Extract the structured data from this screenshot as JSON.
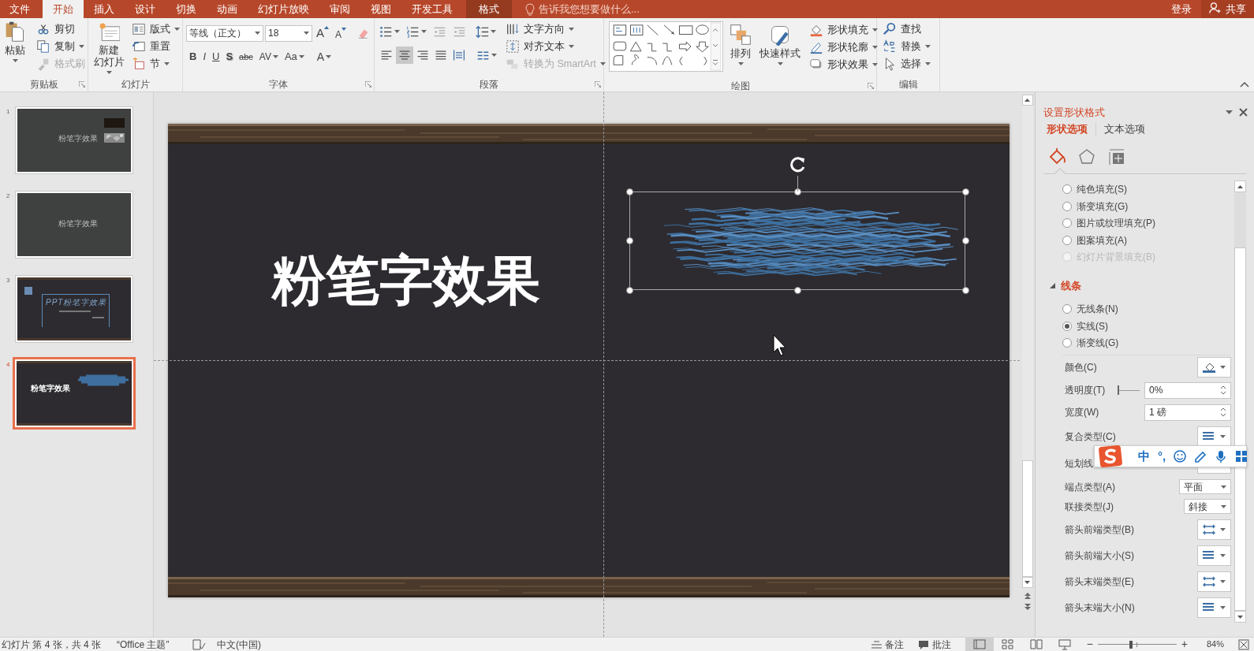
{
  "tabs": [
    {
      "label": "文件",
      "kind": "file",
      "selected": false
    },
    {
      "label": "开始",
      "kind": "normal",
      "selected": true
    },
    {
      "label": "插入",
      "kind": "normal",
      "selected": false
    },
    {
      "label": "设计",
      "kind": "normal",
      "selected": false
    },
    {
      "label": "切换",
      "kind": "normal",
      "selected": false
    },
    {
      "label": "动画",
      "kind": "normal",
      "selected": false
    },
    {
      "label": "幻灯片放映",
      "kind": "normal",
      "selected": false
    },
    {
      "label": "审阅",
      "kind": "normal",
      "selected": false
    },
    {
      "label": "视图",
      "kind": "normal",
      "selected": false
    },
    {
      "label": "开发工具",
      "kind": "normal",
      "selected": false
    },
    {
      "label": "格式",
      "kind": "contextual",
      "selected": false
    }
  ],
  "tell_me": {
    "placeholder": "告诉我您想要做什么..."
  },
  "sign_in": "登录",
  "share": "共享",
  "ribbon": [
    {
      "kind": "clipboard",
      "label": "剪贴板",
      "launcher": true,
      "large": {
        "label": "粘贴",
        "dropdown": true
      },
      "small": [
        {
          "label": "剪切",
          "dropdown": false,
          "disabled": false
        },
        {
          "label": "复制",
          "dropdown": true,
          "disabled": false
        },
        {
          "label": "格式刷",
          "dropdown": false,
          "disabled": true
        }
      ]
    },
    {
      "kind": "slides",
      "label": "幻灯片",
      "launcher": false,
      "large": {
        "label_lines": [
          "新建",
          "幻灯片"
        ],
        "dropdown": true
      },
      "small": [
        {
          "label": "版式",
          "dropdown": true,
          "disabled": false
        },
        {
          "label": "重置",
          "dropdown": false,
          "disabled": false
        },
        {
          "label": "节",
          "dropdown": true,
          "disabled": false
        }
      ]
    },
    {
      "kind": "font",
      "label": "字体",
      "launcher": true,
      "font_name": {
        "value": "等线（正文）"
      },
      "font_size": {
        "value": "18"
      },
      "grow": "A",
      "shrink": "A",
      "buttons": [
        {
          "label": "B",
          "dropdown": false
        },
        {
          "label": "I",
          "dropdown": false
        },
        {
          "label": "U",
          "dropdown": false
        },
        {
          "label": "S",
          "dropdown": false
        },
        {
          "label": "abc",
          "dropdown": false
        },
        {
          "label": "AV",
          "dropdown": true
        },
        {
          "label": "Aa",
          "dropdown": true
        },
        {
          "label": "A",
          "dropdown": true
        }
      ]
    },
    {
      "kind": "paragraph",
      "label": "段落",
      "launcher": true,
      "align_buttons": [
        {
          "selected": false
        },
        {
          "selected": true
        },
        {
          "selected": false
        },
        {
          "selected": false
        },
        {
          "selected": false
        }
      ],
      "small": [
        {
          "label": "文字方向",
          "dropdown": true,
          "disabled": false
        },
        {
          "label": "对齐文本",
          "dropdown": true,
          "disabled": false
        },
        {
          "label": "转换为 SmartArt",
          "dropdown": true,
          "disabled": true
        }
      ]
    },
    {
      "kind": "drawing",
      "label": "绘图",
      "launcher": true,
      "large": [
        {
          "label": "排列",
          "dropdown": true
        },
        {
          "label": "快速样式",
          "dropdown": true
        }
      ],
      "small": [
        {
          "label": "形状填充",
          "dropdown": true,
          "disabled": false
        },
        {
          "label": "形状轮廓",
          "dropdown": true,
          "disabled": false
        },
        {
          "label": "形状效果",
          "dropdown": true,
          "disabled": false
        }
      ]
    },
    {
      "kind": "editing",
      "label": "编辑",
      "launcher": false,
      "small": [
        {
          "label": "查找",
          "dropdown": false,
          "disabled": false
        },
        {
          "label": "替换",
          "dropdown": true,
          "disabled": false
        },
        {
          "label": "选择",
          "dropdown": true,
          "disabled": false
        }
      ]
    }
  ],
  "slides": [
    {
      "number": "1",
      "kind": "grey_logo",
      "title": "粉笔字效果",
      "selected": false
    },
    {
      "number": "2",
      "kind": "grey",
      "title": "粉笔字效果",
      "selected": false
    },
    {
      "number": "3",
      "kind": "chalk",
      "title": "PPT粉笔字效果",
      "selected": false
    },
    {
      "number": "4",
      "kind": "board",
      "title": "粉笔字效果",
      "selected": true
    }
  ],
  "slide": {
    "title": "粉笔字效果"
  },
  "format_pane": {
    "title": "设置形状格式",
    "tabs": [
      {
        "label": "形状选项",
        "selected": true
      },
      {
        "label": "文本选项",
        "selected": false
      }
    ],
    "icon_tabs": [
      {
        "selected": true
      },
      {
        "selected": false
      },
      {
        "selected": false
      }
    ],
    "fill_options": [
      {
        "label": "纯色填充(S)",
        "selected": false,
        "disabled": false
      },
      {
        "label": "渐变填充(G)",
        "selected": false,
        "disabled": false
      },
      {
        "label": "图片或纹理填充(P)",
        "selected": false,
        "disabled": false
      },
      {
        "label": "图案填充(A)",
        "selected": false,
        "disabled": false
      },
      {
        "label": "幻灯片背景填充(B)",
        "selected": false,
        "disabled": true
      }
    ],
    "line_section": {
      "title": "线条",
      "expanded": true,
      "options": [
        {
          "label": "无线条(N)",
          "selected": false
        },
        {
          "label": "实线(S)",
          "selected": true
        },
        {
          "label": "渐变线(G)",
          "selected": false
        }
      ],
      "properties": [
        {
          "label": "颜色(C)",
          "kind": "color"
        },
        {
          "label": "透明度(T)",
          "kind": "slider",
          "level": 0,
          "value": "0%"
        },
        {
          "label": "宽度(W)",
          "kind": "spin",
          "value": "1 磅"
        },
        {
          "label": "复合类型(C)",
          "kind": "lines"
        },
        {
          "label": "短划线",
          "kind": "dash"
        },
        {
          "label": "端点类型(A)",
          "kind": "dropdown",
          "value": "平面"
        },
        {
          "label": "联接类型(J)",
          "kind": "dropdown",
          "value": "斜接"
        },
        {
          "label": "箭头前端类型(B)",
          "kind": "arrows"
        },
        {
          "label": "箭头前端大小(S)",
          "kind": "lines"
        },
        {
          "label": "箭头末端类型(E)",
          "kind": "arrows"
        },
        {
          "label": "箭头末端大小(N)",
          "kind": "lines"
        }
      ]
    }
  },
  "ime_toolbar": {
    "items": [
      "中",
      "°,"
    ]
  },
  "status_bar": {
    "slide_info": "幻灯片 第 4 张，共 4 张",
    "theme": "“Office 主题”",
    "language": "中文(中国)",
    "notes": "备注",
    "comments": "批注",
    "views": [
      {
        "selected": true
      },
      {
        "selected": false
      },
      {
        "selected": false
      },
      {
        "selected": false
      }
    ],
    "zoom": {
      "out": "−",
      "in": "+",
      "level": 0.42,
      "value": "84%"
    }
  }
}
